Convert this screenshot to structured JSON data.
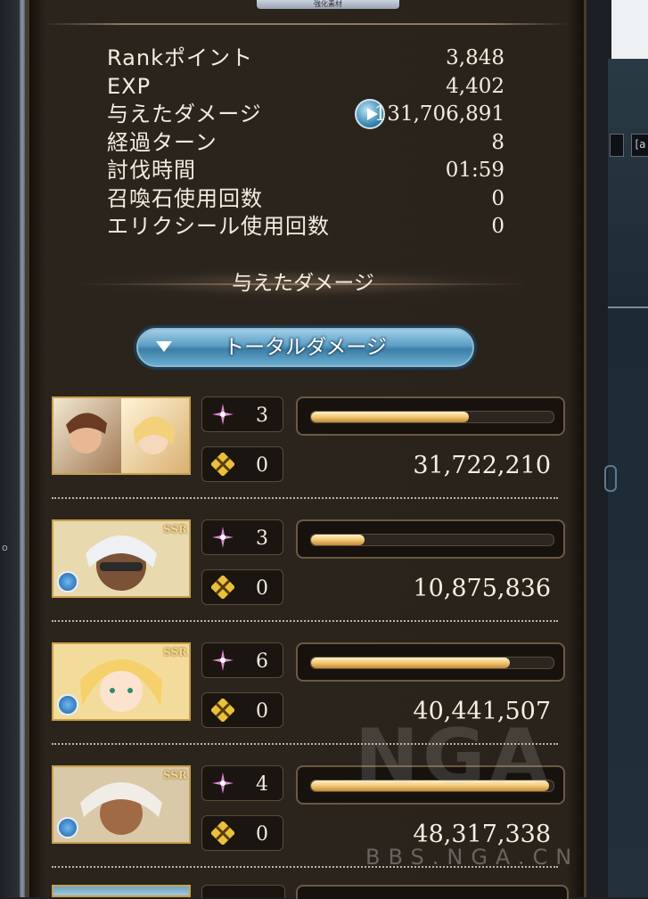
{
  "top_badge": "強化素材",
  "stats": [
    {
      "label": "Rankポイント",
      "value": "3,848"
    },
    {
      "label": "EXP",
      "value": "4,402"
    },
    {
      "label": "与えたダメージ",
      "value": "131,706,891"
    },
    {
      "label": "経過ターン",
      "value": "8"
    },
    {
      "label": "討伐時間",
      "value": "01:59"
    },
    {
      "label": "召喚石使用回数",
      "value": "0"
    },
    {
      "label": "エリクシール使用回数",
      "value": "0"
    }
  ],
  "section_title": "与えたダメージ",
  "total_button_label": "トータルダメージ",
  "characters": [
    {
      "skills": "3",
      "ougi": "0",
      "damage": "31,722,210",
      "bar_percent": 65,
      "rarity": "",
      "element": ""
    },
    {
      "skills": "3",
      "ougi": "0",
      "damage": "10,875,836",
      "bar_percent": 22,
      "rarity": "SSR",
      "element": "water"
    },
    {
      "skills": "6",
      "ougi": "0",
      "damage": "40,441,507",
      "bar_percent": 82,
      "rarity": "SSR",
      "element": "water"
    },
    {
      "skills": "4",
      "ougi": "0",
      "damage": "48,317,338",
      "bar_percent": 98,
      "rarity": "SSR",
      "element": "water"
    }
  ],
  "watermark": {
    "logo": "NGA",
    "url": "BBS.NGA.CN"
  },
  "right_tags": [
    "",
    "[a"
  ]
}
